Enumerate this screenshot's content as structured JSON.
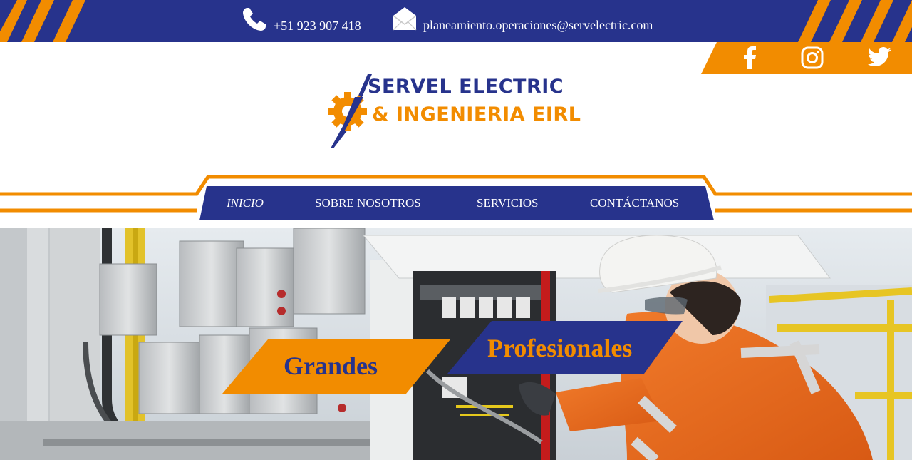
{
  "topbar": {
    "phone": "+51 923 907 418",
    "email": "planeamiento.operaciones@servelectric.com",
    "phone_icon": "phone-icon",
    "mail_icon": "envelope-icon"
  },
  "social": {
    "items": [
      "facebook-icon",
      "instagram-icon",
      "twitter-icon"
    ]
  },
  "logo": {
    "line1": "SERVEL ELECTRIC",
    "line2": "& INGENIERIA EIRL"
  },
  "nav": {
    "items": [
      {
        "label": "INICIO",
        "active": true
      },
      {
        "label": "SOBRE NOSOTROS",
        "active": false
      },
      {
        "label": "SERVICIOS",
        "active": false
      },
      {
        "label": "CONTÁCTANOS",
        "active": false
      }
    ]
  },
  "hero": {
    "tag1": "Grandes",
    "tag2": "Profesionales"
  },
  "colors": {
    "brand_blue": "#27338c",
    "brand_orange": "#f28c00"
  }
}
